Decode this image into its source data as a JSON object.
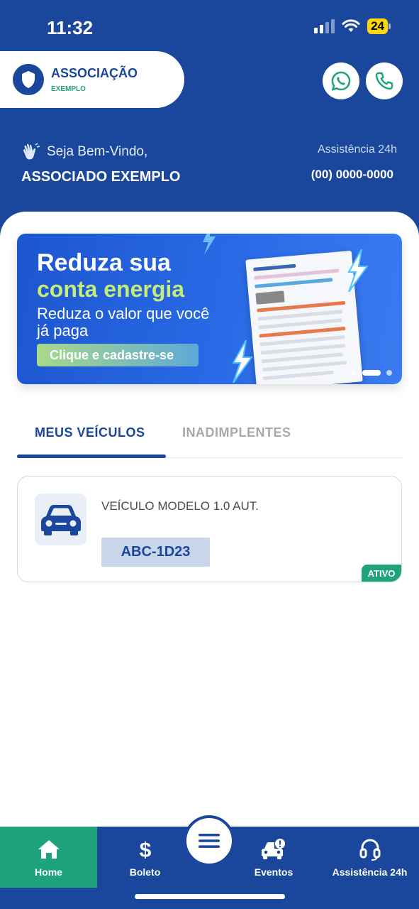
{
  "status_bar": {
    "time": "11:32",
    "battery": "24"
  },
  "header": {
    "logo_title": "ASSOCIAÇÃO",
    "logo_subtitle": "EXEMPLO",
    "welcome": "Seja Bem-Vindo,",
    "user_name": "ASSOCIADO EXEMPLO",
    "assistance_label": "Assistência 24h",
    "assistance_phone": "(00) 0000-0000"
  },
  "banner": {
    "line1": "Reduza sua",
    "line2": "conta energia",
    "line3": "Reduza o valor que você já paga",
    "cta": "Clique e cadastre-se",
    "slide_count": 3,
    "active_slide": 2
  },
  "tabs": [
    {
      "label": "MEUS VEÍCULOS",
      "active": true
    },
    {
      "label": "INADIMPLENTES",
      "active": false
    }
  ],
  "vehicle": {
    "model": "VEÍCULO MODELO 1.0 AUT.",
    "plate": "ABC-1D23",
    "status": "ATIVO"
  },
  "bottom_nav": {
    "home": "Home",
    "boleto": "Boleto",
    "eventos": "Eventos",
    "assistencia": "Assistência 24h"
  },
  "colors": {
    "primary": "#1a479c",
    "accent_green": "#1fa37a",
    "banner_blue": "#2a6ae6",
    "banner_lime": "#c5ec7a"
  },
  "icons": [
    "shield-icon",
    "whatsapp-icon",
    "phone-icon",
    "waving-hand-icon",
    "car-icon",
    "home-icon",
    "dollar-icon",
    "menu-icon",
    "car-alert-icon",
    "headset-icon"
  ]
}
